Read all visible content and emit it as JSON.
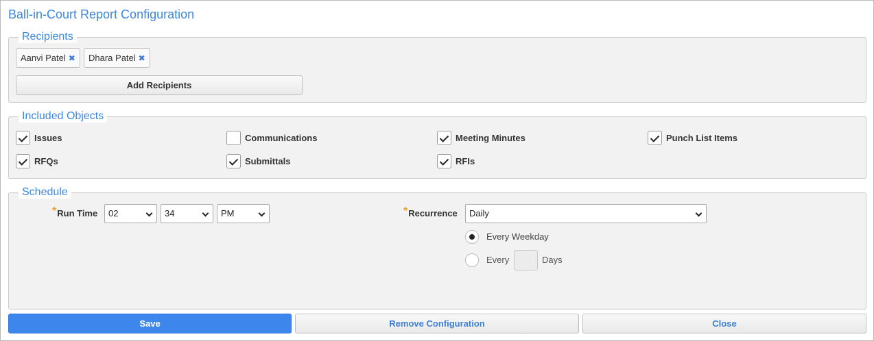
{
  "dialog": {
    "title": "Ball-in-Court Report Configuration"
  },
  "recipients": {
    "legend": "Recipients",
    "tags": [
      {
        "name": "Aanvi Patel",
        "remove_icon": "close-icon"
      },
      {
        "name": "Dhara Patel",
        "remove_icon": "close-icon"
      }
    ],
    "add_button": "Add Recipients"
  },
  "included_objects": {
    "legend": "Included Objects",
    "items": [
      {
        "label": "Issues",
        "checked": true
      },
      {
        "label": "Communications",
        "checked": false
      },
      {
        "label": "Meeting Minutes",
        "checked": true
      },
      {
        "label": "Punch List Items",
        "checked": true
      },
      {
        "label": "RFQs",
        "checked": true
      },
      {
        "label": "Submittals",
        "checked": true
      },
      {
        "label": "RFIs",
        "checked": true
      }
    ]
  },
  "schedule": {
    "legend": "Schedule",
    "required_marker": "*",
    "run_time_label": "Run Time",
    "hour": "02",
    "minute": "34",
    "ampm": "PM",
    "recurrence_label": "Recurrence",
    "recurrence_value": "Daily",
    "option_weekday": "Every Weekday",
    "option_every_prefix": "Every",
    "option_every_suffix": "Days",
    "selected_option": "Every Weekday"
  },
  "footer": {
    "save": "Save",
    "remove": "Remove Configuration",
    "close": "Close"
  },
  "colors": {
    "accent": "#3c86e0",
    "primary_button": "#3d87ec",
    "required": "#f0a030"
  }
}
